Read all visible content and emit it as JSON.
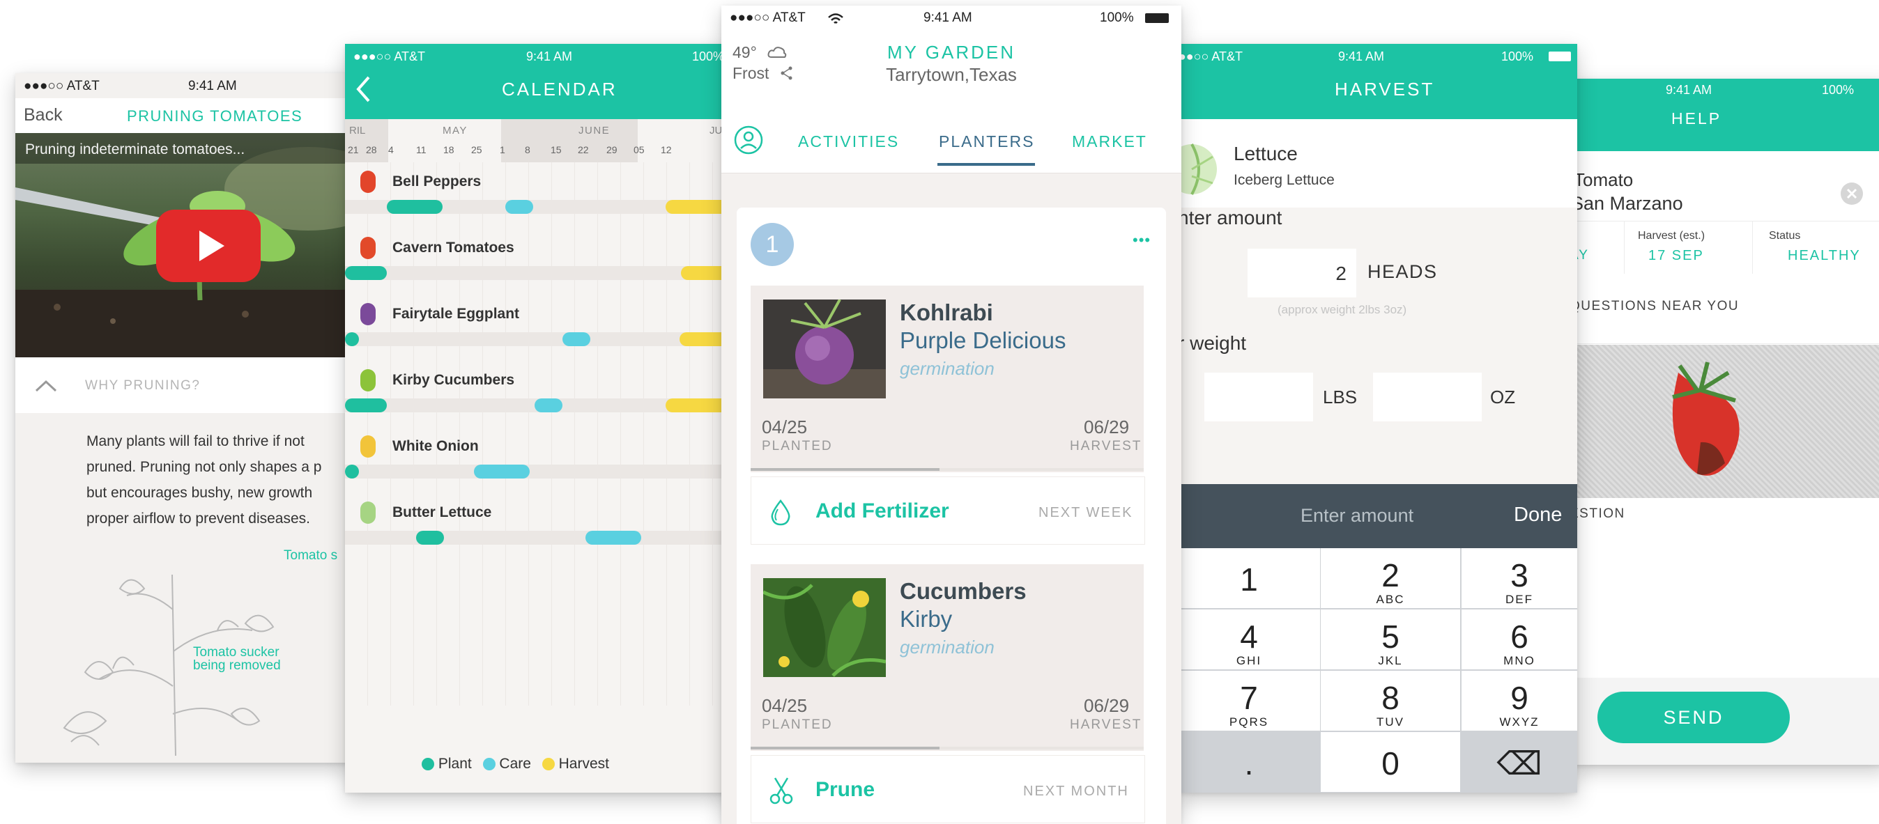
{
  "colors": {
    "teal": "#1cc3a4",
    "dark": "#3d4a52",
    "plant": "#1fbf9f",
    "care": "#5ad0e0",
    "harvest": "#f6d842",
    "keypad_bar": "#45525c"
  },
  "status": {
    "carrier": "●●●○○ AT&T",
    "time": "9:41 AM",
    "battery": "100%"
  },
  "pruning": {
    "back": "Back",
    "title": "PRUNING TOMATOES",
    "video_caption": "Pruning indeterminate tomatoes...",
    "section": "WHY PRUNING?",
    "body": [
      "Many plants will fail to thrive if not",
      "pruned. Pruning not only shapes a p",
      "but encourages bushy, new growth",
      "proper airflow to prevent diseases."
    ],
    "label1": "Tomato s",
    "label2a": "Tomato sucker",
    "label2b": "being removed"
  },
  "calendar": {
    "title": "CALENDAR",
    "months": [
      "RIL",
      "MAY",
      "JUNE",
      "JU"
    ],
    "days": [
      "21",
      "28",
      "4",
      "11",
      "18",
      "25",
      "1",
      "8",
      "15",
      "22",
      "29",
      "05",
      "12"
    ],
    "plants": [
      {
        "name": "Bell Peppers",
        "icon": "bell-pepper-icon"
      },
      {
        "name": "Cavern Tomatoes",
        "icon": "tomato-icon"
      },
      {
        "name": "Fairytale Eggplant",
        "icon": "eggplant-icon"
      },
      {
        "name": "Kirby Cucumbers",
        "icon": "cucumber-icon"
      },
      {
        "name": "White Onion",
        "icon": "onion-icon"
      },
      {
        "name": "Butter Lettuce",
        "icon": "lettuce-icon"
      }
    ],
    "legend": {
      "plant": "Plant",
      "care": "Care",
      "harvest": "Harvest"
    }
  },
  "garden": {
    "weather_temp": "49°",
    "weather_frost": "Frost",
    "title": "MY GARDEN",
    "location": "Tarrytown,Texas",
    "tabs": [
      "ACTIVITIES",
      "PLANTERS",
      "MARKET"
    ],
    "planter_number": "1",
    "more": "•••",
    "cards": [
      {
        "name": "Kohlrabi",
        "variety": "Purple Delicious",
        "stage": "germination",
        "planted_date": "04/25",
        "planted_label": "PLANTED",
        "harvest_date": "06/29",
        "harvest_label": "HARVEST",
        "progress": 0.48,
        "task": "Add Fertilizer",
        "task_when": "NEXT WEEK",
        "task_icon": "water-drop-icon"
      },
      {
        "name": "Cucumbers",
        "variety": "Kirby",
        "stage": "germination",
        "planted_date": "04/25",
        "planted_label": "PLANTED",
        "harvest_date": "06/29",
        "harvest_label": "HARVEST",
        "progress": 0.48,
        "task": "Prune",
        "task_when": "NEXT MONTH",
        "task_icon": "scissors-icon"
      }
    ]
  },
  "harvest": {
    "title": "HARVEST",
    "plant": "Lettuce",
    "variety": "Iceberg Lettuce",
    "enter_amount": "nter amount",
    "amount_value": "2",
    "amount_unit": "HEADS",
    "approx": "(approx weight 2lbs 3oz)",
    "weight_label": "r weight",
    "lbs": "LBS",
    "oz": "OZ",
    "keypad_placeholder": "Enter amount",
    "done": "Done",
    "keys": [
      {
        "n": "1",
        "l": ""
      },
      {
        "n": "2",
        "l": "ABC"
      },
      {
        "n": "3",
        "l": "DEF"
      },
      {
        "n": "4",
        "l": "GHI"
      },
      {
        "n": "5",
        "l": "JKL"
      },
      {
        "n": "6",
        "l": "MNO"
      },
      {
        "n": "7",
        "l": "PQRS"
      },
      {
        "n": "8",
        "l": "TUV"
      },
      {
        "n": "9",
        "l": "WXYZ"
      },
      {
        "n": ".",
        "l": ""
      },
      {
        "n": "0",
        "l": ""
      },
      {
        "n": "⌫",
        "l": ""
      }
    ]
  },
  "help": {
    "title": "HELP",
    "plant": "Tomato",
    "variety": "San Marzano",
    "harvest_label": "Harvest (est.)",
    "harvest_value": "17 SEP",
    "status_label": "Status",
    "status_value": "HEALTHY",
    "left_value": "AY",
    "questions": "QUESTIONS NEAR YOU",
    "question_label": "ESTION",
    "send": "SEND"
  }
}
